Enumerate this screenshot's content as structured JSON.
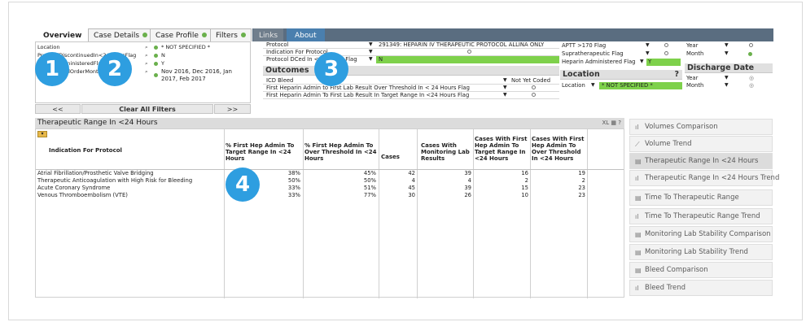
{
  "tabs": [
    {
      "label": "Overview",
      "dot": false
    },
    {
      "label": "Case Details",
      "dot": true
    },
    {
      "label": "Case Profile",
      "dot": true
    },
    {
      "label": "Filters",
      "dot": true
    },
    {
      "label": "Links",
      "dot": false
    },
    {
      "label": "About",
      "dot": false
    }
  ],
  "current_selections": [
    {
      "field": "Location",
      "value": "* NOT SPECIFIED *"
    },
    {
      "field": "ProtocolDiscontinuedIn<24HoursFlag",
      "value": "N"
    },
    {
      "field": "HeparinAdministeredFlag",
      "value": "Y"
    },
    {
      "field": "FirstProtocolOrderMonth",
      "value": "Nov 2016, Dec 2016, Jan 2017, Feb 2017"
    }
  ],
  "nav": {
    "prev": "<<",
    "clear": "Clear All Filters",
    "next": ">>"
  },
  "filters": {
    "protocol_label": "Protocol",
    "protocol_value": "291349: HEPARIN IV THERAPEUTIC PROTOCOL ALLINA ONLY",
    "indication_label": "Indication For Protocol",
    "dced_label": "Protocol DCed In <24 Hours Flag",
    "dced_value": "N",
    "outcomes_title": "Outcomes",
    "icd_bleed_label": "ICD Bleed",
    "icd_bleed_value": "Not Yet Coded",
    "over_threshold_label": "First Heparin Admin to First Lab Result Over Threshold In < 24 Hours Flag",
    "target_range_label": "First Heparin Admin To First Lab Result In Target Range In <24 Hours Flag"
  },
  "right_filters": {
    "aptt_label": "APTT >170 Flag",
    "supra_label": "Supratherapeutic Flag",
    "heparin_label": "Heparin Administered Flag",
    "heparin_value": "Y",
    "location_title": "Location",
    "location_help": "?",
    "location_label": "Location",
    "location_value": "* NOT SPECIFIED *",
    "year_label": "Year",
    "month_label": "Month",
    "discharge_title": "Discharge Date",
    "d_year_label": "Year",
    "d_month_label": "Month"
  },
  "chart_title": "Therapeutic Range In <24 Hours",
  "title_icons": "XL ▦ ?",
  "table": {
    "headers": [
      "Indication For Protocol",
      "% First Hep Admin To Target Range In <24 Hours",
      "% First Hep Admin To Over Threshold In <24 Hours",
      "Cases",
      "Cases With Monitoring Lab Results",
      "Cases With First Hep Admin To Target Range In <24 Hours",
      "Cases With First Hep Admin To Over Threshold In <24 Hours"
    ],
    "rows": [
      [
        "Atrial Fibrillation/Prosthetic Valve Bridging",
        "38%",
        "45%",
        "42",
        "39",
        "16",
        "19"
      ],
      [
        "Therapeutic Anticoagulation with High Risk for Bleeding",
        "50%",
        "50%",
        "4",
        "4",
        "2",
        "2"
      ],
      [
        "Acute Coronary Syndrome",
        "33%",
        "51%",
        "45",
        "39",
        "15",
        "23"
      ],
      [
        "Venous Thromboembolism (VTE)",
        "33%",
        "77%",
        "30",
        "26",
        "10",
        "23"
      ]
    ]
  },
  "side_charts": [
    {
      "label": "Volumes Comparison",
      "icon": "bar-chart-icon",
      "selected": false
    },
    {
      "label": "Volume Trend",
      "icon": "line-chart-icon",
      "selected": false
    },
    {
      "label": "Therapeutic Range In <24 Hours",
      "icon": "table-icon",
      "selected": true
    },
    {
      "label": "Therapeutic Range In <24 Hours Trend",
      "icon": "bar-chart-icon",
      "selected": false
    },
    {
      "label": "Time To Therapeutic Range",
      "icon": "table-icon",
      "selected": false
    },
    {
      "label": "Time To Therapeutic Range Trend",
      "icon": "bar-chart-icon",
      "selected": false
    },
    {
      "label": "Monitoring Lab Stability Comparison",
      "icon": "table-icon",
      "selected": false
    },
    {
      "label": "Monitoring Lab Stability Trend",
      "icon": "table-icon",
      "selected": false
    },
    {
      "label": "Bleed Comparison",
      "icon": "table-icon",
      "selected": false
    },
    {
      "label": "Bleed Trend",
      "icon": "bar-chart-icon",
      "selected": false
    }
  ],
  "callouts": [
    "1",
    "2",
    "3",
    "4"
  ],
  "colors": {
    "callout": "#2e9ee0",
    "selected_green": "#7ed14b",
    "tabbar": "#5a6d80",
    "about_tab": "#4a7fae"
  }
}
